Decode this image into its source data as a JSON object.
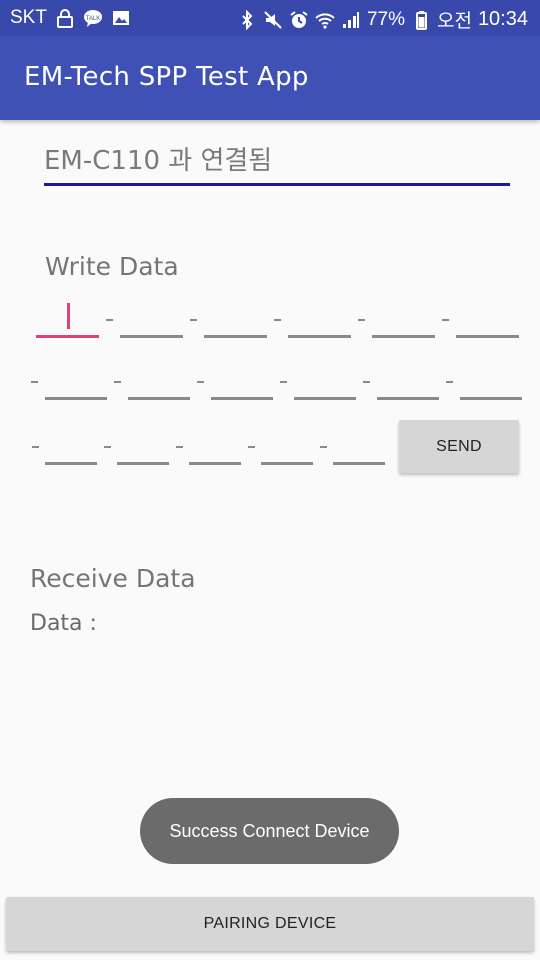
{
  "status_bar": {
    "carrier": "SKT",
    "battery": "77%",
    "time_label": "오전",
    "time": "10:34",
    "icons_left": [
      "lock-icon",
      "talk-icon",
      "gallery-icon"
    ],
    "icons_right": [
      "bluetooth-icon",
      "mute-icon",
      "alarm-icon",
      "wifi-icon",
      "signal-icon",
      "battery-icon"
    ]
  },
  "app_bar": {
    "title": "EM-Tech SPP Test App"
  },
  "connection": {
    "status": "EM-C110 과 연결됨"
  },
  "write": {
    "title": "Write Data",
    "fields_row1": 6,
    "fields_row2": 6,
    "fields_row3": 5,
    "send_label": "SEND"
  },
  "receive": {
    "title": "Receive Data",
    "data_label": "Data :"
  },
  "toast": {
    "message": "Success Connect Device"
  },
  "pairing": {
    "button_label": "PAIRING DEVICE"
  },
  "colors": {
    "status_bar": "#3949ab",
    "app_bar": "#3f51b5",
    "accent": "#e0407a",
    "connection_underline": "#1a1aa0"
  }
}
